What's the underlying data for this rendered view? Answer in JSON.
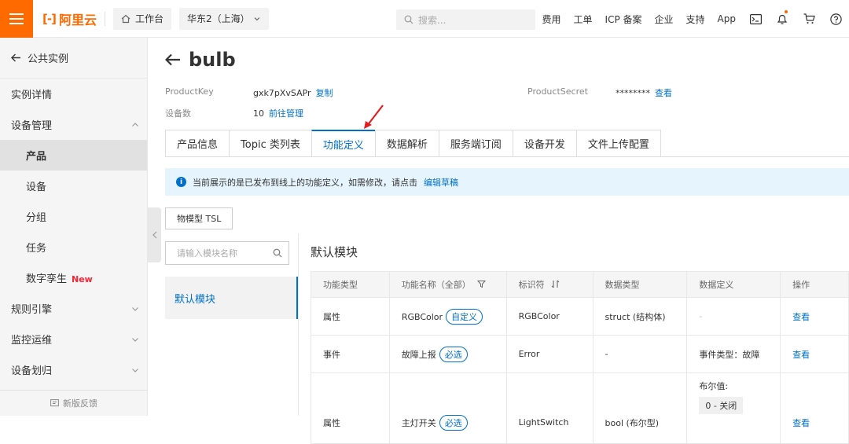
{
  "topbar": {
    "logo": "阿里云",
    "workbench": "工作台",
    "region": "华东2（上海）",
    "search_placeholder": "搜索...",
    "nav": [
      "费用",
      "工单",
      "ICP 备案",
      "企业",
      "支持",
      "App"
    ]
  },
  "sidebar": {
    "back": "公共实例",
    "items": [
      {
        "label": "实例详情"
      },
      {
        "label": "设备管理"
      },
      {
        "label": "产品"
      },
      {
        "label": "设备"
      },
      {
        "label": "分组"
      },
      {
        "label": "任务"
      },
      {
        "label": "数字孪生",
        "badge": "New"
      },
      {
        "label": "规则引擎"
      },
      {
        "label": "监控运维"
      },
      {
        "label": "设备划归"
      }
    ],
    "feedback": "新版反馈"
  },
  "page": {
    "title": "bulb",
    "product_key_label": "ProductKey",
    "product_key": "gxk7pXvSAPr",
    "copy": "复制",
    "device_count_label": "设备数",
    "device_count": "10",
    "manage": "前往管理",
    "secret_label": "ProductSecret",
    "secret": "********",
    "view": "查看"
  },
  "tabs": [
    "产品信息",
    "Topic 类列表",
    "功能定义",
    "数据解析",
    "服务端订阅",
    "设备开发",
    "文件上传配置"
  ],
  "notice": {
    "text": "当前展示的是已发布到线上的功能定义，如需修改，请点击",
    "link": "编辑草稿"
  },
  "tsl_button": "物模型 TSL",
  "module_search_placeholder": "请输入模块名称",
  "module_item": "默认模块",
  "module_title": "默认模块",
  "table": {
    "headers": [
      "功能类型",
      "功能名称（全部）",
      "标识符",
      "数据类型",
      "数据定义",
      "操作"
    ],
    "rows": [
      {
        "type": "属性",
        "name": "RGBColor",
        "tag": "自定义",
        "id": "RGBColor",
        "dtype": "struct (结构体)",
        "def": "-",
        "def2": "",
        "op": "查看"
      },
      {
        "type": "事件",
        "name": "故障上报",
        "tag": "必选",
        "id": "Error",
        "dtype": "-",
        "def": "事件类型：故障",
        "def2": "",
        "op": "查看"
      },
      {
        "type": "属性",
        "name": "主灯开关",
        "tag": "必选",
        "id": "LightSwitch",
        "dtype": "bool (布尔型)",
        "def": "布尔值:",
        "def2": "0 - 关闭",
        "op": "查看"
      }
    ]
  },
  "colors": {
    "brand": "#ff6a00",
    "link": "#0070cc",
    "annotation": "#e02020"
  }
}
